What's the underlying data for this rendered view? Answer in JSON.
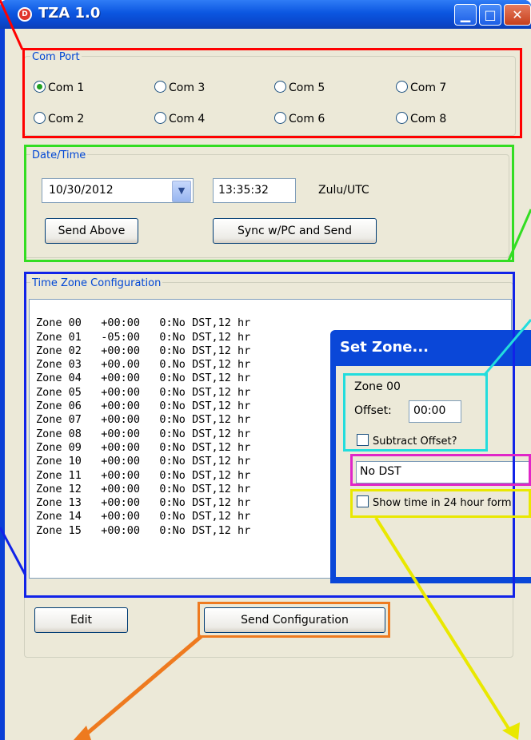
{
  "window": {
    "title": "TZA 1.0",
    "icon_glyph": "D"
  },
  "com_port": {
    "label": "Com Port",
    "options": [
      "Com 1",
      "Com 2",
      "Com 3",
      "Com 4",
      "Com 5",
      "Com 6",
      "Com 7",
      "Com 8"
    ],
    "selected": "Com 1"
  },
  "datetime": {
    "label": "Date/Time",
    "date_value": "10/30/2012",
    "time_value": "13:35:32",
    "zone_label": "Zulu/UTC",
    "send_above_label": "Send Above",
    "sync_label": "Sync w/PC and Send"
  },
  "tz_config": {
    "label": "Time Zone Configuration",
    "rows": [
      "Zone 00   +00:00   0:No DST,12 hr",
      "Zone 01   -05:00   0:No DST,12 hr",
      "Zone 02   +00:00   0:No DST,12 hr",
      "Zone 03   +00.00   0.No DST,12 hr",
      "Zone 04   +00:00   0:No DST,12 hr",
      "Zone 05   +00:00   0:No DST,12 hr",
      "Zone 06   +00:00   0:No DST,12 hr",
      "Zone 07   +00:00   0:No DST,12 hr",
      "Zone 08   +00:00   0:No DST,12 hr",
      "Zone 09   +00:00   0:No DST,12 hr",
      "Zone 10   +00:00   0:No DST,12 hr",
      "Zone 11   +00:00   0:No DST,12 hr",
      "Zone 12   +00:00   0:No DST,12 hr",
      "Zone 13   +00:00   0:No DST,12 hr",
      "Zone 14   +00:00   0:No DST,12 hr",
      "Zone 15   +00:00   0:No DST,12 hr"
    ],
    "edit_label": "Edit",
    "send_config_label": "Send Configuration"
  },
  "set_zone_dialog": {
    "title": "Set Zone...",
    "zone_name": "Zone 00",
    "offset_label": "Offset:",
    "offset_value": "00:00",
    "subtract_label": "Subtract Offset?",
    "dst_value": "No DST",
    "show24_label": "Show time in 24 hour form"
  },
  "colors": {
    "titlebar_blue": "#0b56e0",
    "window_bg": "#ece9d8",
    "group_label_blue": "#0046d5",
    "annotation_red": "#ff0000",
    "annotation_green": "#33dd22",
    "annotation_blue": "#1123e8",
    "annotation_cyan": "#22dddd",
    "annotation_magenta": "#e026c8",
    "annotation_yellow": "#e9e800",
    "annotation_orange": "#ee7a1f"
  }
}
